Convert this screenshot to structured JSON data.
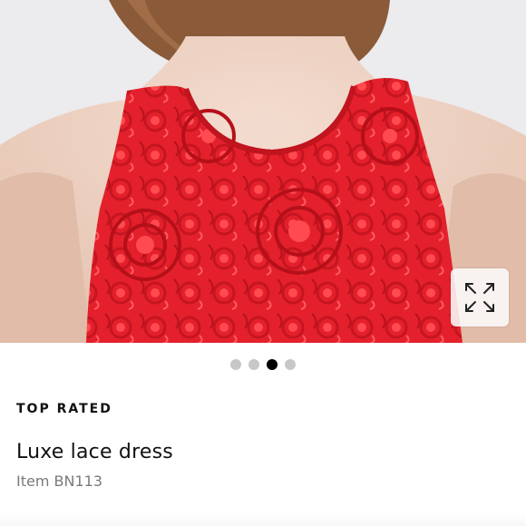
{
  "product": {
    "badge": "TOP RATED",
    "title": "Luxe lace dress",
    "item_number": "Item BN113"
  },
  "gallery": {
    "image_count": 4,
    "active_index": 2,
    "expand_icon": "expand-arrows-icon"
  },
  "colors": {
    "dress_red": "#e2212c",
    "background": "#ecebee",
    "active_dot": "#000000",
    "inactive_dot": "#c7c7c7"
  }
}
